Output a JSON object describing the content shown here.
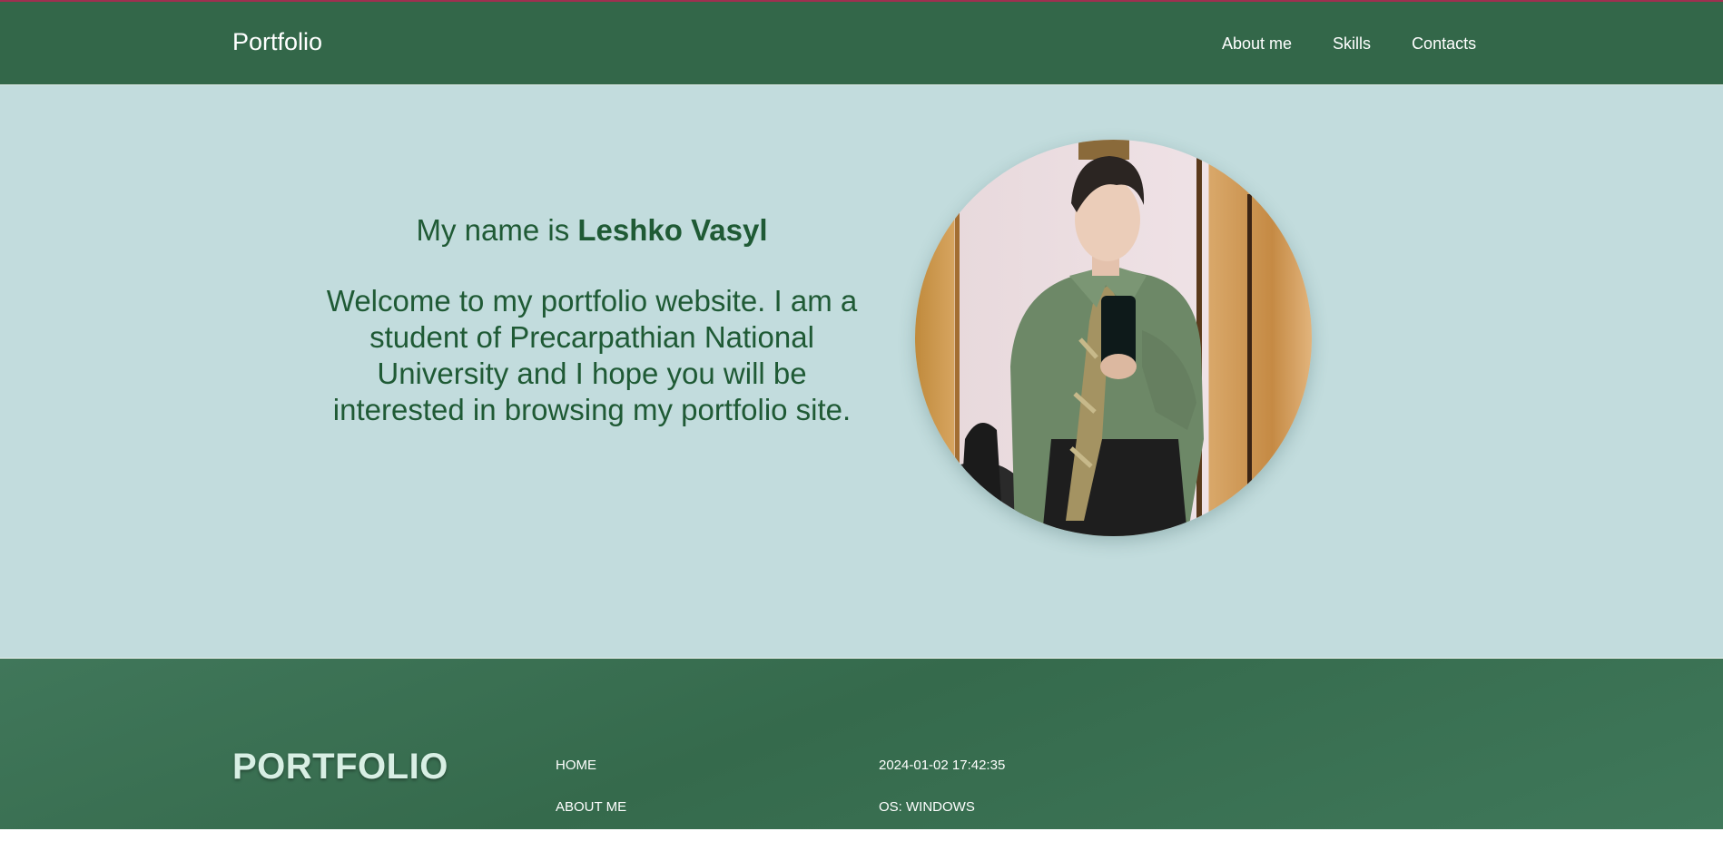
{
  "header": {
    "brand": "Portfolio",
    "nav": [
      "About me",
      "Skills",
      "Contacts"
    ]
  },
  "hero": {
    "name_prefix": "My name is ",
    "name": "Leshko Vasyl",
    "welcome": "Welcome to my portfolio website. I am a student of Precarpathian National University and I hope you will be interested in browsing my portfolio site."
  },
  "footer": {
    "title": "PORTFOLIO",
    "links": [
      "HOME",
      "ABOUT ME"
    ],
    "datetime": "2024-01-02 17:42:35",
    "os": "OS: WINDOWS"
  },
  "colors": {
    "header_bg": "#336749",
    "hero_bg": "#c2dcdd",
    "text_green": "#1f5a35",
    "footer_bg": "#3a6f52"
  }
}
